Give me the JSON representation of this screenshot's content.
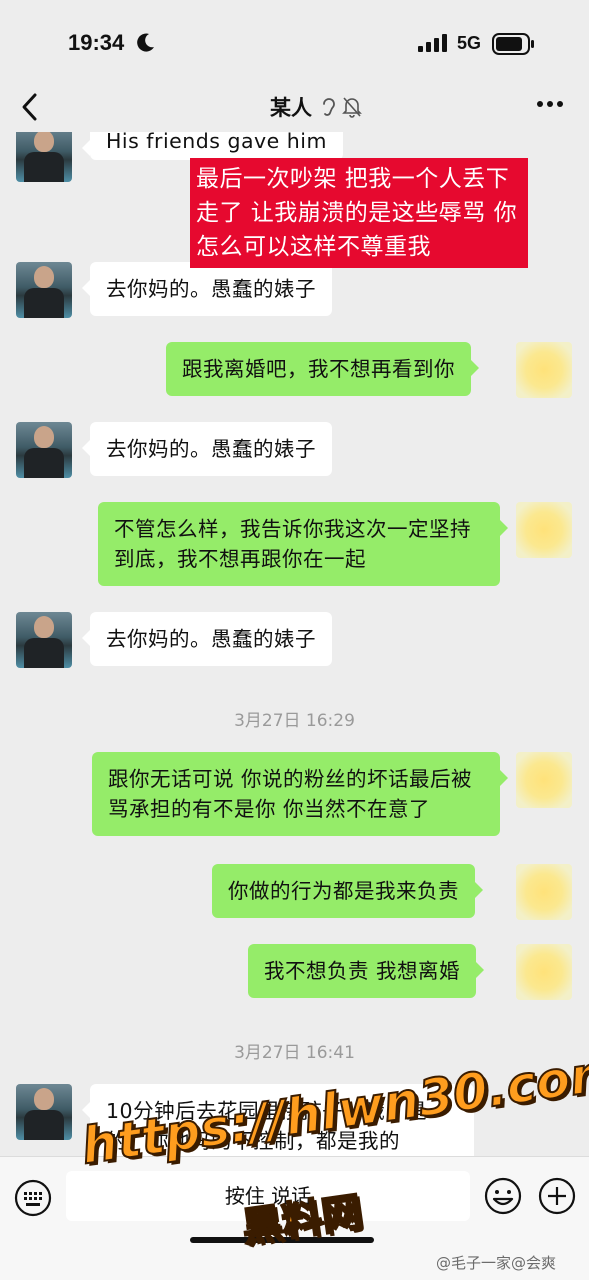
{
  "status": {
    "time": "19:34",
    "network": "5G",
    "icons": [
      "moon-icon",
      "signal-icon",
      "battery-icon"
    ]
  },
  "header": {
    "title": "某人",
    "back_icon": "chevron-left-icon",
    "ear_icon": "earpiece-icon",
    "mute_icon": "mute-bell-icon",
    "more_icon": "more-dots-icon"
  },
  "overlay_note": "最后一次吵架 把我一个人丢下走了 让我崩溃的是这些辱骂 你怎么可以这样不尊重我",
  "messages": [
    {
      "side": "in",
      "text": "His friends gave him"
    },
    {
      "side": "in",
      "text": "去你妈的。愚蠢的婊子"
    },
    {
      "side": "out",
      "text": "跟我离婚吧，我不想再看到你"
    },
    {
      "side": "in",
      "text": "去你妈的。愚蠢的婊子"
    },
    {
      "side": "out",
      "text": "不管怎么样，我告诉你我这次一定坚持到底，我不想再跟你在一起"
    },
    {
      "side": "in",
      "text": "去你妈的。愚蠢的婊子"
    },
    {
      "side": "out",
      "text": "跟你无话可说 你说的粉丝的坏话最后被骂承担的有不是你 你当然不在意了"
    },
    {
      "side": "out",
      "text": "你做的行为都是我来负责"
    },
    {
      "side": "out",
      "text": "我不想负责 我想离婚"
    },
    {
      "side": "in",
      "text": "10分钟后去花园里接孩子。哦，是的，你他妈的不控制，都是我的"
    }
  ],
  "timestamps": [
    "3月27日 16:29",
    "3月27日 16:41"
  ],
  "input": {
    "label": "按住 说话",
    "icons": [
      "keyboard-voice-icon",
      "emoji-icon",
      "plus-icon"
    ]
  },
  "watermark": {
    "url": "https://hlwn30.com",
    "site": "黑料网",
    "credit": "@毛子一家@会爽"
  },
  "colors": {
    "incoming_bubble": "#ffffff",
    "outgoing_bubble": "#95ec69",
    "note_background": "#e6092f",
    "chat_background": "#ededed"
  }
}
